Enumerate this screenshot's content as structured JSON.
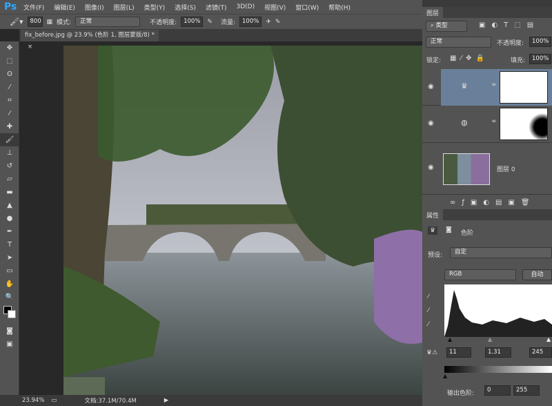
{
  "app": {
    "logo": "Ps"
  },
  "menu": [
    "文件(F)",
    "编辑(E)",
    "图像(I)",
    "图层(L)",
    "类型(Y)",
    "选择(S)",
    "滤镜(T)",
    "3D(D)",
    "视图(V)",
    "窗口(W)",
    "帮助(H)"
  ],
  "options": {
    "brush_size": "800",
    "mode_label": "模式:",
    "mode_value": "正常",
    "opacity_label": "不透明度:",
    "opacity_value": "100%",
    "flow_label": "流量:",
    "flow_value": "100%"
  },
  "document_tab": {
    "title": "fix_before.jpg @ 23.9% (色阶 1, 图层蒙版/8) *",
    "close": "×"
  },
  "status": {
    "zoom": "23.94%",
    "doc": "文档:37.1M/70.4M"
  },
  "layers_panel": {
    "tab": "图层",
    "filter_kind": "类型",
    "blend_mode": "正常",
    "opacity_label": "不透明度:",
    "opacity_value": "100%",
    "lock_label": "锁定:",
    "fill_label": "填充:",
    "fill_value": "100%",
    "layers": [
      {
        "type": "levels-adjustment",
        "selected": true
      },
      {
        "type": "hue-adjustment",
        "selected": false
      },
      {
        "name": "图层 0",
        "selected": false
      }
    ]
  },
  "properties_panel": {
    "tab": "属性",
    "title": "色阶",
    "preset_label": "预设:",
    "preset_value": "自定",
    "channel": "RGB",
    "auto_button": "自动",
    "input_black": "11",
    "input_gamma": "1.31",
    "input_white": "245",
    "output_label": "输出色阶:",
    "output_black": "0",
    "output_white": "255"
  },
  "colors": {
    "ui_bg": "#535353",
    "selected_layer": "#6a7f99",
    "logo": "#31a8ff"
  }
}
